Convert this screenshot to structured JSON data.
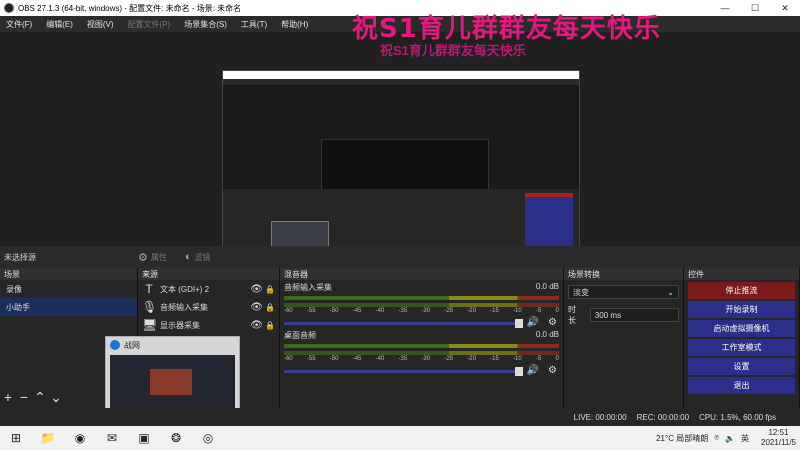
{
  "window": {
    "title": "OBS 27.1.3 (64-bit, windows) - 配置文件: 未命名 - 场景: 未命名",
    "minimize": "—",
    "maximize": "☐",
    "close": "✕"
  },
  "menu": {
    "items": [
      "文件(F)",
      "编辑(E)",
      "视图(V)",
      "配置文件(P)",
      "场景集合(S)",
      "工具(T)",
      "帮助(H)"
    ]
  },
  "overlay": {
    "banner": "祝S1育儿群群友每天快乐",
    "banner_echo": "祝S1育儿群群友每天快乐"
  },
  "source_toolbar": {
    "no_scene": "未选择源",
    "properties": "属性",
    "filters": "滤镜"
  },
  "docks": {
    "scenes": {
      "title": "场景",
      "items": [
        "录像",
        "小助手"
      ]
    },
    "sources": {
      "title": "来源",
      "items": [
        {
          "label": "文本 (GDI+) 2",
          "icon": "text-icon"
        },
        {
          "label": "音频输入采集",
          "icon": "mic-icon"
        },
        {
          "label": "显示器采集",
          "icon": "monitor-icon"
        }
      ]
    },
    "mixer": {
      "title": "混音器",
      "channels": [
        {
          "name": "音频输入采集",
          "db": "0.0 dB"
        },
        {
          "name": "桌面音频",
          "db": "0.0 dB"
        }
      ],
      "ticks": [
        "-60",
        "-55",
        "-50",
        "-45",
        "-40",
        "-35",
        "-30",
        "-25",
        "-20",
        "-15",
        "-10",
        "-5",
        "0"
      ]
    },
    "transitions": {
      "title": "场景转换",
      "selected": "淡变",
      "duration_label": "时长",
      "duration": "300 ms"
    },
    "controls": {
      "title": "控件",
      "buttons": [
        "停止推流",
        "开始录制",
        "启动虚拟摄像机",
        "工作室模式",
        "设置",
        "退出"
      ]
    }
  },
  "thumbnail": {
    "title": "战网"
  },
  "status": {
    "live": "LIVE: 00:00:00",
    "rec": "REC: 00:00:00",
    "cpu": "CPU: 1.5%, 60.00 fps"
  },
  "taskbar": {
    "weather": "21°C 局部晴朗",
    "ime": "英",
    "time": "12:51",
    "date": "2021/11/5"
  }
}
